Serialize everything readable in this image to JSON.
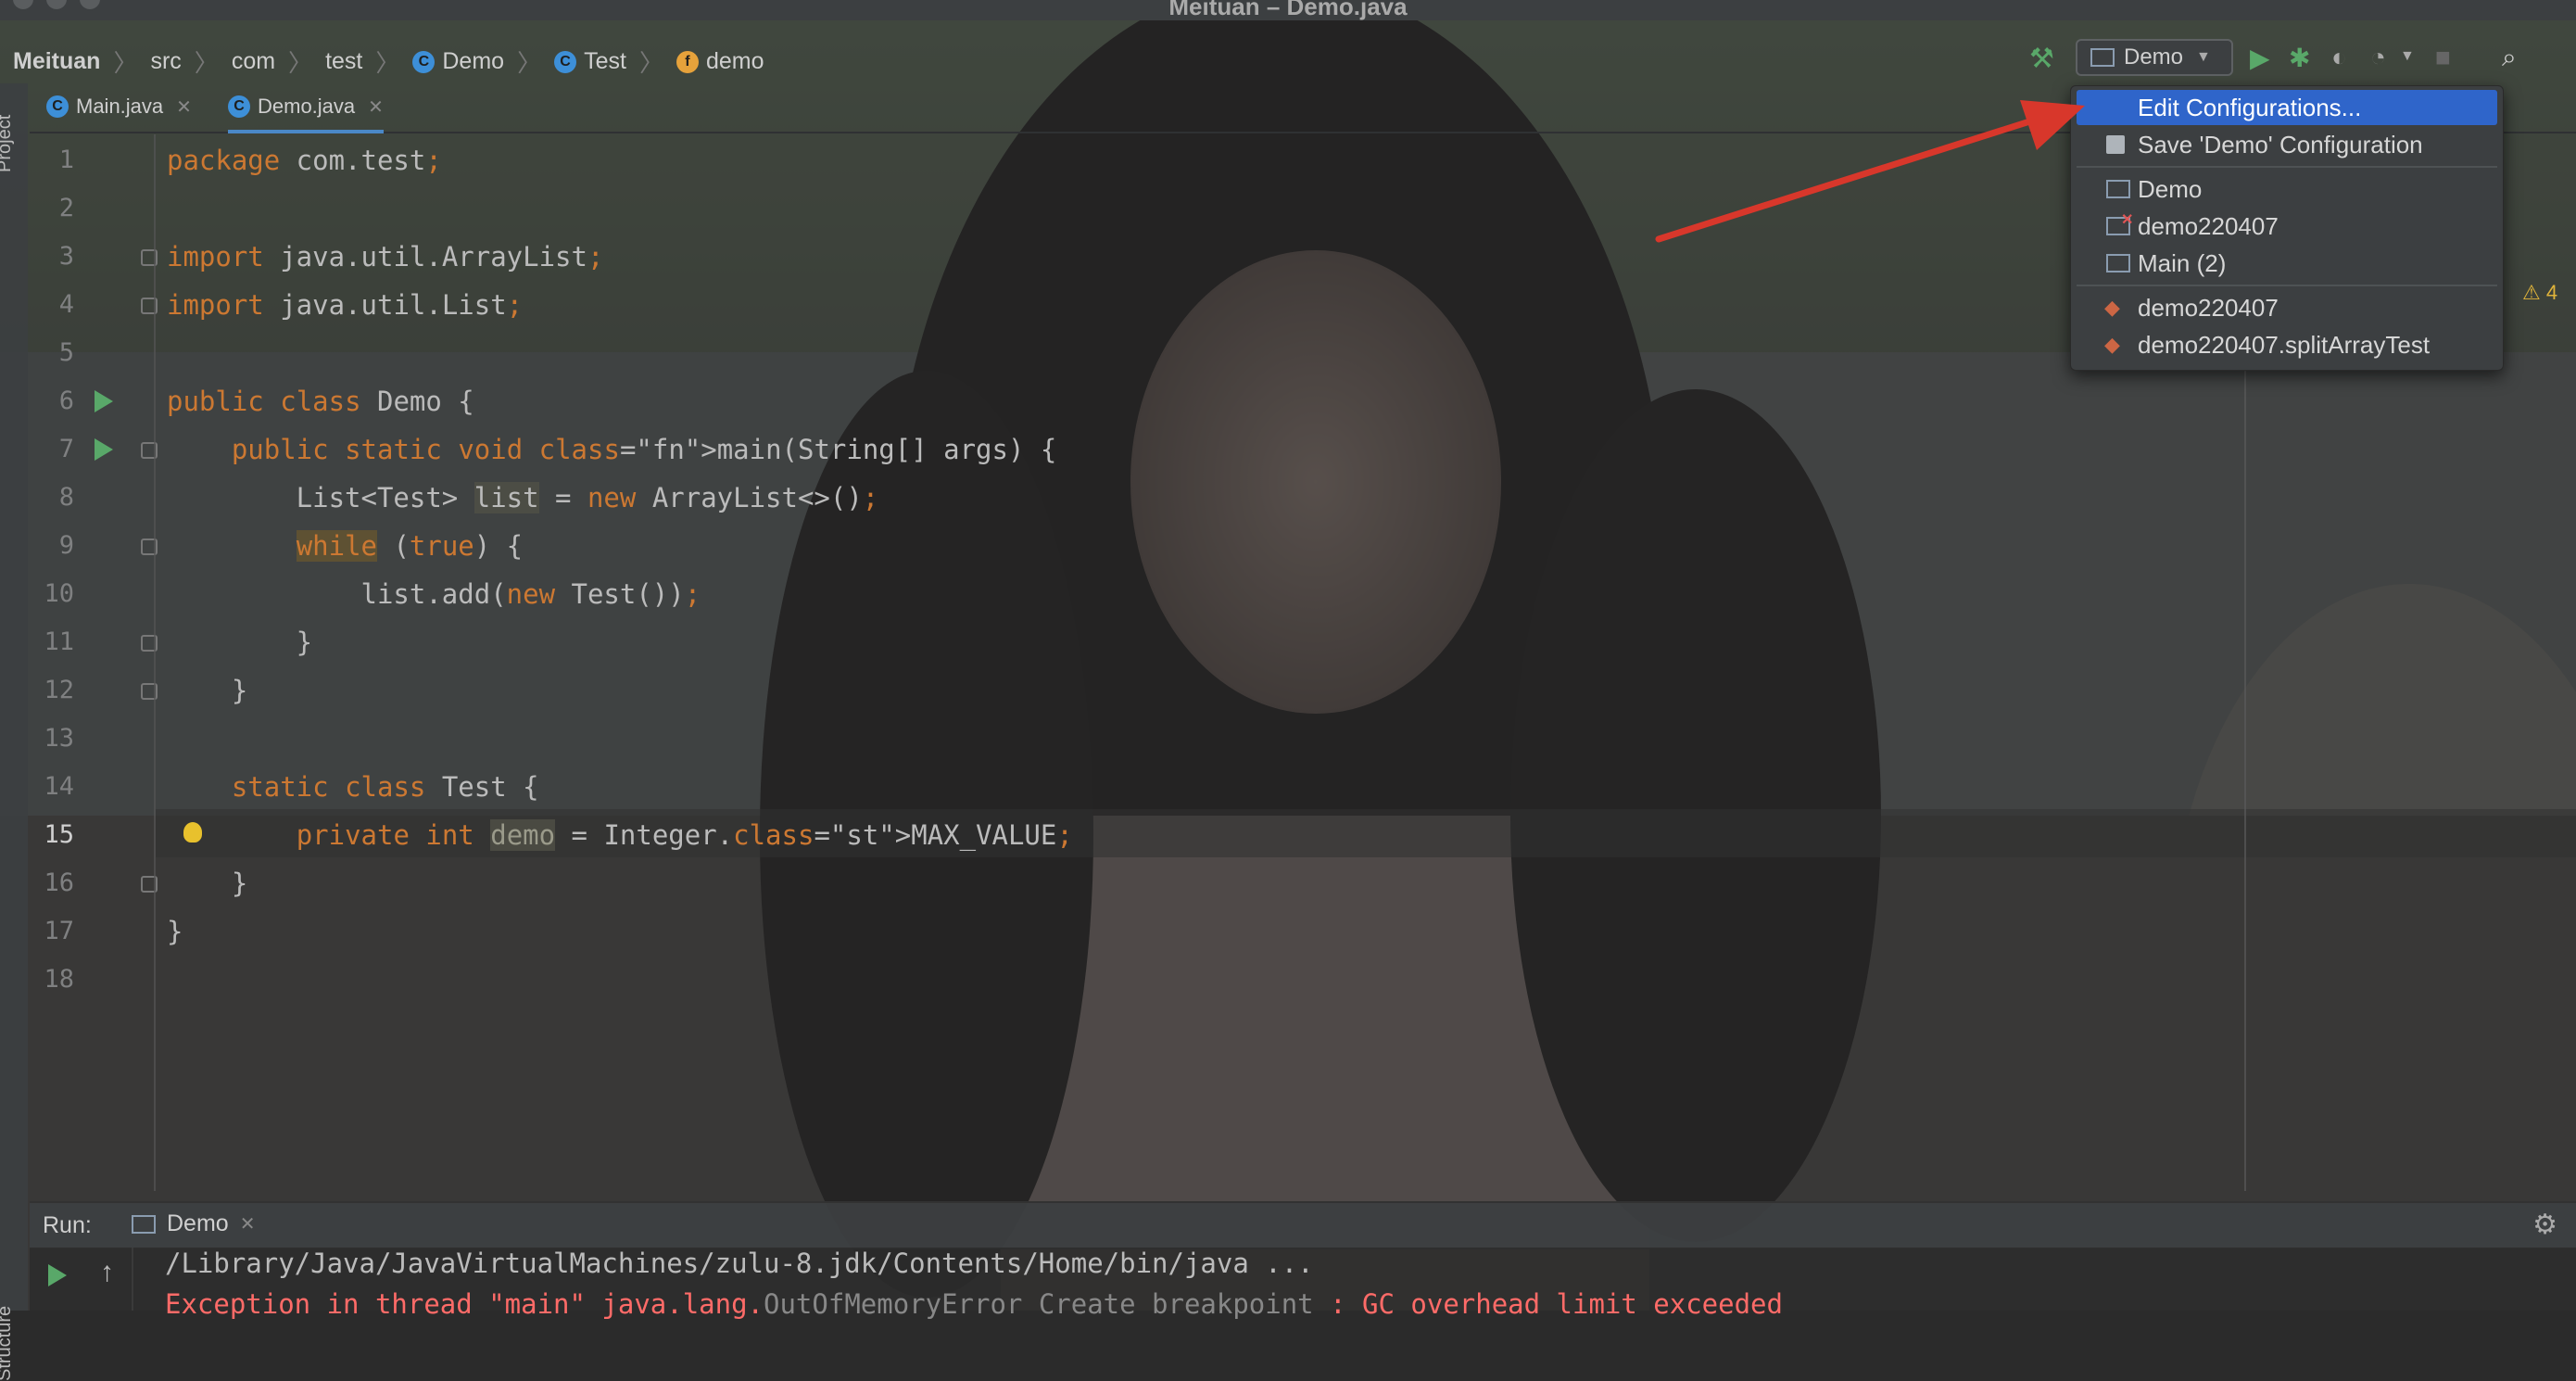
{
  "window": {
    "title": "Meituan – Demo.java"
  },
  "breadcrumbs": [
    {
      "label": "Meituan",
      "icon": ""
    },
    {
      "label": "src",
      "icon": ""
    },
    {
      "label": "com",
      "icon": ""
    },
    {
      "label": "test",
      "icon": ""
    },
    {
      "label": "Demo",
      "icon": "class-icon"
    },
    {
      "label": "Test",
      "icon": "class-icon"
    },
    {
      "label": "demo",
      "icon": "field-icon"
    }
  ],
  "toolbar": {
    "run_config": "Demo"
  },
  "tool_windows": {
    "project": "Project",
    "structure": "Structure"
  },
  "tabs": [
    {
      "label": "Main.java",
      "active": false
    },
    {
      "label": "Demo.java",
      "active": true
    }
  ],
  "editor": {
    "current_line": "15",
    "warning_count": "4",
    "line_numbers": [
      "1",
      "2",
      "3",
      "4",
      "5",
      "6",
      "7",
      "8",
      "9",
      "10",
      "11",
      "12",
      "13",
      "14",
      "15",
      "16",
      "17",
      "18"
    ],
    "lines": [
      "package com.test;",
      "",
      "import java.util.ArrayList;",
      "import java.util.List;",
      "",
      "public class Demo {",
      "    public static void main(String[] args) {",
      "        List<Test> list = new ArrayList<>();",
      "        while (true) {",
      "            list.add(new Test());",
      "        }",
      "    }",
      "",
      "    static class Test {",
      "        private int demo = Integer.MAX_VALUE;",
      "    }",
      "}",
      ""
    ]
  },
  "run_config_menu": {
    "items": [
      {
        "label": "Edit Configurations...",
        "selected": true
      },
      {
        "label": "Save 'Demo' Configuration"
      },
      {
        "label": "Demo"
      },
      {
        "label": "demo220407"
      },
      {
        "label": "Main (2)"
      },
      {
        "label": "demo220407"
      },
      {
        "label": "demo220407.splitArrayTest"
      }
    ]
  },
  "run_panel": {
    "label": "Run:",
    "tab": "Demo",
    "output": [
      "/Library/Java/JavaVirtualMachines/zulu-8.jdk/Contents/Home/bin/java ...",
      "Exception in thread \"main\" java.lang.",
      "OutOfMemoryError",
      " Create breakpoint",
      " : GC overhead limit exceeded"
    ]
  },
  "colors": {
    "keyword": "#cc7832",
    "method": "#ffc66d",
    "static_field": "#9876aa",
    "selection": "#2f65ca",
    "error": "#ff6b68",
    "annotation_arrow": "#d8372b"
  }
}
